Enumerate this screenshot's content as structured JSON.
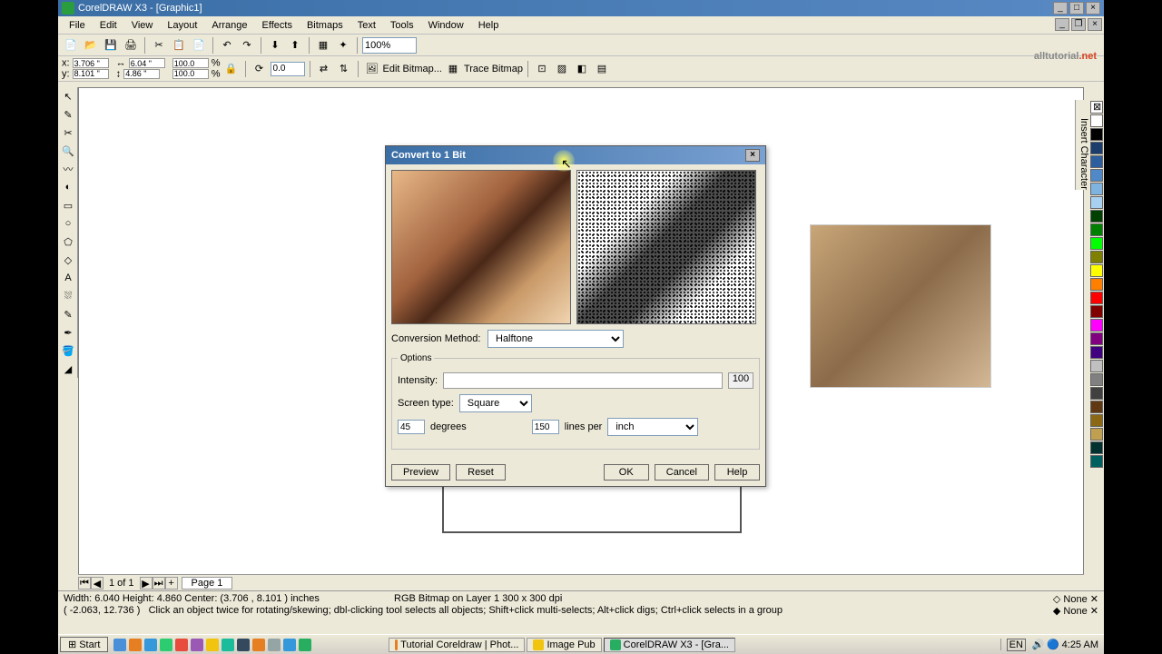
{
  "app": {
    "title": "CorelDRAW X3 - [Graphic1]",
    "menus": [
      "File",
      "Edit",
      "View",
      "Layout",
      "Arrange",
      "Effects",
      "Bitmaps",
      "Text",
      "Tools",
      "Window",
      "Help"
    ],
    "zoom": "100%",
    "coords": {
      "x": "3.706 \"",
      "y": "8.101 \"",
      "w": "6.04 \"",
      "h": "4.86 \""
    },
    "scale": {
      "sx": "100.0",
      "sy": "100.0"
    },
    "rotation": "0.0",
    "edit_bitmap": "Edit Bitmap...",
    "trace_bitmap": "Trace Bitmap",
    "ruler_unit": "inches",
    "page_of": "1 of 1",
    "page_tab": "Page 1",
    "status1": "Width: 6.040   Height: 4.860   Center: (3.706 , 8.101 )   inches",
    "status2": "RGB Bitmap on Layer 1 300 x 300 dpi",
    "status_coord": "( -2.063, 12.736 )",
    "status_hint": "Click an object twice for rotating/skewing; dbl-clicking tool selects all objects; Shift+click multi-selects; Alt+click digs; Ctrl+click selects in a group",
    "fill_none": "None",
    "outline_none": "None",
    "docker": "Insert Character"
  },
  "logo": {
    "part1": "alltutorial",
    "part2": ".net"
  },
  "dialog": {
    "title": "Convert to 1 Bit",
    "conv_method_label": "Conversion Method:",
    "conv_method": "Halftone",
    "options_label": "Options",
    "intensity_label": "Intensity:",
    "intensity_value": "100",
    "screen_type_label": "Screen type:",
    "screen_type": "Square",
    "degrees_val": "45",
    "degrees_label": "degrees",
    "lines_val": "150",
    "lines_label": "lines per",
    "lines_unit": "inch",
    "btn_preview": "Preview",
    "btn_reset": "Reset",
    "btn_ok": "OK",
    "btn_cancel": "Cancel",
    "btn_help": "Help"
  },
  "palette": [
    "#ffffff",
    "#000000",
    "#1a3d6b",
    "#2d5f9e",
    "#5089c7",
    "#7fb3e0",
    "#a8d0f0",
    "#004000",
    "#008000",
    "#00ff00",
    "#808000",
    "#ffff00",
    "#ff8000",
    "#ff0000",
    "#800000",
    "#ff00ff",
    "#800080",
    "#400080",
    "#c0c0c0",
    "#808080",
    "#404040",
    "#603913",
    "#8b6914",
    "#c0a050",
    "#003030",
    "#006060"
  ],
  "taskbar": {
    "start": "Start",
    "items": [
      "Tutorial Coreldraw | Phot...",
      "Image Pub",
      "CorelDRAW X3 - [Gra..."
    ],
    "clock": "4:25 AM",
    "lang": "EN"
  }
}
